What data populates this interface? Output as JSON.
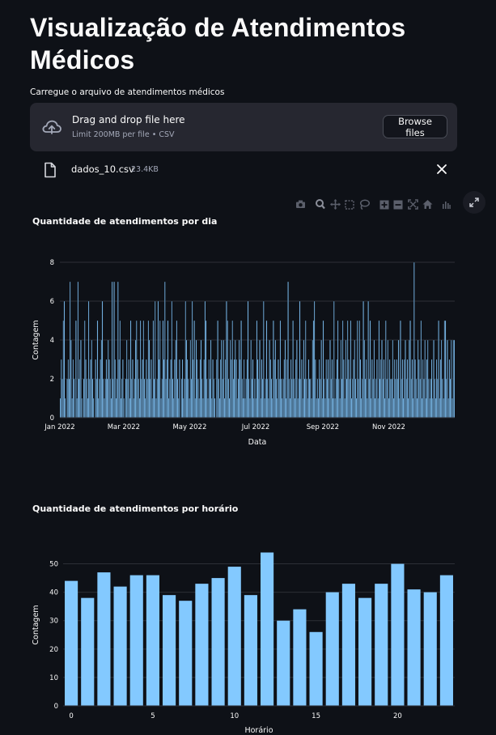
{
  "page": {
    "title": "Visualização de Atendimentos Médicos"
  },
  "uploader": {
    "label": "Carregue o arquivo de atendimentos médicos",
    "drag_text": "Drag and drop file here",
    "limit_text": "Limit 200MB per file • CSV",
    "browse_label": "Browse files",
    "file_name": "dados_10.csv",
    "file_size": "23.4KB"
  },
  "colors": {
    "background": "#0e1117",
    "bar": "#83c9ff",
    "bar_edge": "#0e1117",
    "grid": "#2d3037",
    "axis_text": "#fafafa"
  },
  "icons": [
    "camera-icon",
    "zoom-icon",
    "pan-icon",
    "box-select-icon",
    "lasso-icon",
    "zoom-in-icon",
    "zoom-out-icon",
    "autoscale-icon",
    "home-icon",
    "plotly-logo-icon",
    "expand-icon",
    "cloud-upload-icon",
    "file-icon",
    "close-icon"
  ],
  "chart_data": [
    {
      "type": "bar",
      "title": "Quantidade de atendimentos por dia",
      "xlabel": "Data",
      "ylabel": "Contagem",
      "x_start": "2022-01-01",
      "x_end": "2022-12-31",
      "x_ticks": [
        "Jan 2022",
        "Mar 2022",
        "May 2022",
        "Jul 2022",
        "Sep 2022",
        "Nov 2022"
      ],
      "y_ticks": [
        "0",
        "2",
        "4",
        "6",
        "8"
      ],
      "ylim": [
        0,
        8
      ],
      "grid": true,
      "values": [
        1,
        3,
        2,
        5,
        6,
        1,
        0,
        2,
        3,
        2,
        7,
        4,
        1,
        3,
        2,
        0,
        5,
        1,
        7,
        2,
        3,
        4,
        1,
        0,
        2,
        5,
        3,
        2,
        1,
        6,
        2,
        3,
        4,
        2,
        1,
        0,
        3,
        2,
        5,
        1,
        2,
        3,
        4,
        6,
        2,
        1,
        2,
        3,
        2,
        4,
        3,
        2,
        1,
        7,
        2,
        7,
        3,
        1,
        2,
        7,
        3,
        5,
        1,
        2,
        3,
        1,
        0,
        2,
        4,
        2,
        3,
        1,
        5,
        2,
        3,
        1,
        2,
        4,
        5,
        3,
        2,
        1,
        5,
        2,
        3,
        5,
        2,
        1,
        3,
        2,
        5,
        4,
        2,
        3,
        1,
        5,
        2,
        6,
        1,
        2,
        6,
        3,
        5,
        1,
        2,
        5,
        3,
        7,
        2,
        3,
        5,
        1,
        2,
        3,
        6,
        2,
        1,
        3,
        4,
        5,
        2,
        1,
        3,
        0,
        2,
        3,
        1,
        2,
        6,
        4,
        3,
        2,
        1,
        4,
        2,
        6,
        3,
        5,
        1,
        4,
        3,
        2,
        1,
        3,
        4,
        2,
        1,
        3,
        6,
        5,
        2,
        1,
        3,
        2,
        4,
        1,
        3,
        2,
        1,
        0,
        3,
        5,
        2,
        1,
        3,
        4,
        2,
        4,
        1,
        3,
        6,
        5,
        2,
        1,
        4,
        3,
        5,
        2,
        3,
        4,
        3,
        1,
        2,
        4,
        3,
        5,
        2,
        1,
        3,
        1,
        2,
        3,
        6,
        2,
        1,
        4,
        2,
        3,
        1,
        2,
        1,
        5,
        3,
        2,
        4,
        1,
        3,
        2,
        6,
        1,
        2,
        5,
        2,
        1,
        4,
        3,
        2,
        1,
        5,
        3,
        4,
        2,
        1,
        3,
        2,
        5,
        2,
        1,
        2,
        3,
        4,
        1,
        3,
        7,
        2,
        1,
        3,
        2,
        5,
        2,
        1,
        3,
        4,
        1,
        2,
        6,
        2,
        3,
        1,
        4,
        2,
        5,
        2,
        1,
        3,
        2,
        2,
        1,
        4,
        5,
        6,
        3,
        1,
        2,
        1,
        3,
        2,
        4,
        1,
        5,
        2,
        1,
        3,
        2,
        3,
        1,
        4,
        2,
        3,
        1,
        6,
        1,
        2,
        3,
        5,
        2,
        1,
        4,
        2,
        5,
        3,
        1,
        4,
        2,
        5,
        3,
        2,
        5,
        1,
        2,
        3,
        4,
        2,
        1,
        5,
        2,
        5,
        3,
        1,
        2,
        6,
        4,
        2,
        3,
        1,
        6,
        2,
        5,
        1,
        3,
        2,
        4,
        1,
        2,
        3,
        1,
        5,
        2,
        3,
        4,
        2,
        3,
        1,
        5,
        2,
        4,
        1,
        3,
        2,
        2,
        4,
        1,
        3,
        2,
        3,
        2,
        4,
        1,
        5,
        2,
        3,
        1,
        3,
        4,
        2,
        3,
        1,
        4,
        5,
        2,
        3,
        1,
        8,
        3,
        2,
        1,
        4,
        3,
        2,
        5,
        1,
        3,
        2,
        4,
        1,
        3,
        4,
        2,
        1,
        2,
        3,
        1,
        4,
        2,
        1,
        3,
        2,
        5,
        1,
        3,
        4,
        2,
        1,
        5,
        5,
        2,
        4,
        1,
        3,
        2,
        4,
        1,
        4,
        4
      ]
    },
    {
      "type": "bar",
      "title": "Quantidade de atendimentos por horário",
      "xlabel": "Horário",
      "ylabel": "Contagem",
      "categories": [
        0,
        1,
        2,
        3,
        4,
        5,
        6,
        7,
        8,
        9,
        10,
        11,
        12,
        13,
        14,
        15,
        16,
        17,
        18,
        19,
        20,
        21,
        22,
        23
      ],
      "values": [
        44,
        38,
        47,
        42,
        46,
        46,
        39,
        37,
        43,
        45,
        49,
        39,
        54,
        30,
        34,
        26,
        40,
        43,
        38,
        43,
        50,
        41,
        40,
        46
      ],
      "x_ticks": [
        "0",
        "5",
        "10",
        "15",
        "20"
      ],
      "y_ticks": [
        "0",
        "10",
        "20",
        "30",
        "40",
        "50"
      ],
      "ylim": [
        0,
        57
      ],
      "grid": true
    }
  ]
}
